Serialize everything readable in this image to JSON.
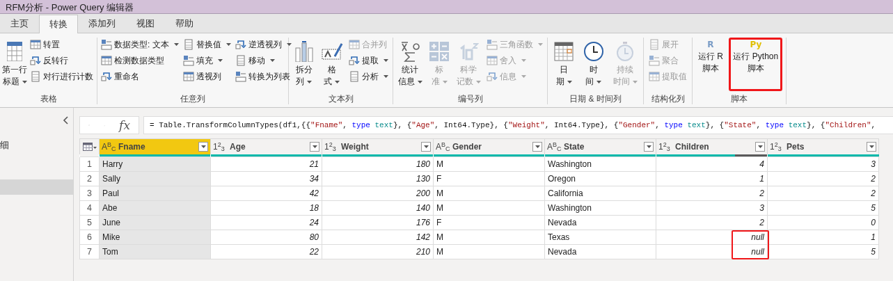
{
  "window": {
    "title": "RFM分析 - Power Query 编辑器"
  },
  "tabs": [
    {
      "label": "主页",
      "selected": false
    },
    {
      "label": "转换",
      "selected": true
    },
    {
      "label": "添加列",
      "selected": false
    },
    {
      "label": "视图",
      "selected": false
    },
    {
      "label": "帮助",
      "selected": false
    }
  ],
  "ribbon": {
    "groups": [
      {
        "label": "表格",
        "items": [
          {
            "kind": "large",
            "lines": [
              "第一行",
              "标题"
            ],
            "dropdown": true,
            "disabled": false
          },
          {
            "kind": "stack",
            "items": [
              {
                "label": "转置",
                "dropdown": false,
                "disabled": false
              },
              {
                "label": "反转行",
                "dropdown": false,
                "disabled": false
              },
              {
                "label": "对行进行计数",
                "dropdown": false,
                "disabled": false
              }
            ]
          }
        ]
      },
      {
        "label": "任意列",
        "items": [
          {
            "kind": "stack",
            "items": [
              {
                "label": "数据类型: 文本",
                "dropdown": true,
                "disabled": false
              },
              {
                "label": "检测数据类型",
                "dropdown": false,
                "disabled": false
              },
              {
                "label": "重命名",
                "dropdown": false,
                "disabled": false
              }
            ]
          },
          {
            "kind": "stack",
            "items": [
              {
                "label": "替换值",
                "dropdown": true,
                "disabled": false
              },
              {
                "label": "填充",
                "dropdown": true,
                "disabled": false
              },
              {
                "label": "透视列",
                "dropdown": false,
                "disabled": false
              }
            ]
          },
          {
            "kind": "stack",
            "items": [
              {
                "label": "逆透视列",
                "dropdown": true,
                "disabled": false
              },
              {
                "label": "移动",
                "dropdown": true,
                "disabled": false
              },
              {
                "label": "转换为列表",
                "dropdown": false,
                "disabled": false
              }
            ]
          }
        ]
      },
      {
        "label": "文本列",
        "items": [
          {
            "kind": "large",
            "lines": [
              "拆分",
              "列"
            ],
            "dropdown": true,
            "disabled": false
          },
          {
            "kind": "large",
            "lines": [
              "格",
              "式"
            ],
            "dropdown": true,
            "disabled": false
          },
          {
            "kind": "stack",
            "items": [
              {
                "label": "合并列",
                "dropdown": false,
                "disabled": true
              },
              {
                "label": "提取",
                "dropdown": true,
                "disabled": false
              },
              {
                "label": "分析",
                "dropdown": true,
                "disabled": false
              }
            ]
          }
        ]
      },
      {
        "label": "编号列",
        "items": [
          {
            "kind": "large",
            "lines": [
              "统计",
              "信息"
            ],
            "dropdown": true,
            "disabled": false
          },
          {
            "kind": "large",
            "lines": [
              "标",
              "准"
            ],
            "dropdown": true,
            "disabled": true
          },
          {
            "kind": "large",
            "lines": [
              "科学",
              "记数"
            ],
            "dropdown": true,
            "disabled": true
          },
          {
            "kind": "stack",
            "items": [
              {
                "label": "三角函数",
                "dropdown": true,
                "disabled": true
              },
              {
                "label": "舍入",
                "dropdown": true,
                "disabled": true
              },
              {
                "label": "信息",
                "dropdown": true,
                "disabled": true
              }
            ]
          }
        ]
      },
      {
        "label": "日期 & 时间列",
        "items": [
          {
            "kind": "large",
            "lines": [
              "日",
              "期"
            ],
            "dropdown": true,
            "disabled": false
          },
          {
            "kind": "large",
            "lines": [
              "时",
              "间"
            ],
            "dropdown": true,
            "disabled": false
          },
          {
            "kind": "large",
            "lines": [
              "持续",
              "时间"
            ],
            "dropdown": true,
            "disabled": true
          }
        ]
      },
      {
        "label": "结构化列",
        "items": [
          {
            "kind": "stack",
            "items": [
              {
                "label": "展开",
                "dropdown": false,
                "disabled": true
              },
              {
                "label": "聚合",
                "dropdown": false,
                "disabled": true
              },
              {
                "label": "提取值",
                "dropdown": false,
                "disabled": true
              }
            ]
          }
        ]
      },
      {
        "label": "脚本",
        "items": [
          {
            "kind": "glyph",
            "glyph": "R",
            "color": "#7a9cc6",
            "lines": [
              "运行 R",
              "脚本"
            ],
            "highlighted": false
          },
          {
            "kind": "glyph",
            "glyph": "Py",
            "color": "#e0c000",
            "lines": [
              "运行 Python",
              "脚本"
            ],
            "highlighted": true
          }
        ]
      }
    ]
  },
  "queries": [
    {
      "label": "细",
      "selected": false
    },
    {
      "selected": true
    }
  ],
  "formula_bar": {
    "fx_glyph": "fx",
    "segments": [
      {
        "kind": "plain",
        "text": "= Table.TransformColumnTypes(df1,{{"
      },
      {
        "kind": "string",
        "text": "\"Fname\""
      },
      {
        "kind": "plain",
        "text": ", "
      },
      {
        "kind": "keyword",
        "text": "type"
      },
      {
        "kind": "type",
        "text": " text"
      },
      {
        "kind": "plain",
        "text": "}, {"
      },
      {
        "kind": "string",
        "text": "\"Age\""
      },
      {
        "kind": "plain",
        "text": ", Int64.Type}, {"
      },
      {
        "kind": "string",
        "text": "\"Weight\""
      },
      {
        "kind": "plain",
        "text": ", Int64.Type}, {"
      },
      {
        "kind": "string",
        "text": "\"Gender\""
      },
      {
        "kind": "plain",
        "text": ", "
      },
      {
        "kind": "keyword",
        "text": "type"
      },
      {
        "kind": "type",
        "text": " text"
      },
      {
        "kind": "plain",
        "text": "}, {"
      },
      {
        "kind": "string",
        "text": "\"State\""
      },
      {
        "kind": "plain",
        "text": ", "
      },
      {
        "kind": "keyword",
        "text": "type"
      },
      {
        "kind": "type",
        "text": " text"
      },
      {
        "kind": "plain",
        "text": "}, {"
      },
      {
        "kind": "string",
        "text": "\"Children\""
      },
      {
        "kind": "plain",
        "text": ","
      }
    ]
  },
  "table": {
    "columns": [
      {
        "name": "Fname",
        "type_glyph": "A$^{B}$$_{C}$",
        "kind": "text",
        "selected": true,
        "highlighted": false,
        "level": 1
      },
      {
        "name": "Age",
        "type_glyph": "1$^{2}$$_{3}$",
        "kind": "number",
        "selected": false,
        "highlighted": false,
        "level": 1
      },
      {
        "name": "Weight",
        "type_glyph": "1$^{2}$$_{3}$",
        "kind": "number",
        "selected": false,
        "highlighted": false,
        "level": 1
      },
      {
        "name": "Gender",
        "type_glyph": "A$^{B}$$_{C}$",
        "kind": "text",
        "selected": false,
        "highlighted": false,
        "level": 1
      },
      {
        "name": "State",
        "type_glyph": "A$^{B}$$_{C}$",
        "kind": "text",
        "selected": false,
        "highlighted": false,
        "level": 1
      },
      {
        "name": "Children",
        "type_glyph": "1$^{2}$$_{3}$",
        "kind": "number",
        "selected": false,
        "highlighted": true,
        "level": 0.71
      },
      {
        "name": "Pets",
        "type_glyph": "1$^{2}$$_{3}$",
        "kind": "number",
        "selected": false,
        "highlighted": false,
        "level": 1
      }
    ],
    "rows": [
      {
        "number": "1",
        "highlighted": false,
        "cells": [
          "Harry",
          "21",
          "180",
          "M",
          "Washington",
          "4",
          "3"
        ]
      },
      {
        "number": "2",
        "highlighted": false,
        "cells": [
          "Sally",
          "34",
          "130",
          "F",
          "Oregon",
          "1",
          "2"
        ]
      },
      {
        "number": "3",
        "highlighted": false,
        "cells": [
          "Paul",
          "42",
          "200",
          "M",
          "California",
          "2",
          "2"
        ]
      },
      {
        "number": "4",
        "highlighted": false,
        "cells": [
          "Abe",
          "18",
          "140",
          "M",
          "Washington",
          "3",
          "5"
        ]
      },
      {
        "number": "5",
        "highlighted": false,
        "cells": [
          "June",
          "24",
          "176",
          "F",
          "Nevada",
          "2",
          "0"
        ]
      },
      {
        "number": "6",
        "highlighted": true,
        "cells": [
          "Mike",
          "80",
          "142",
          "M",
          "Texas",
          "null",
          "1"
        ]
      },
      {
        "number": "7",
        "highlighted": true,
        "cells": [
          "Tom",
          "22",
          "210",
          "M",
          "Nevada",
          "null",
          "5"
        ]
      }
    ]
  }
}
